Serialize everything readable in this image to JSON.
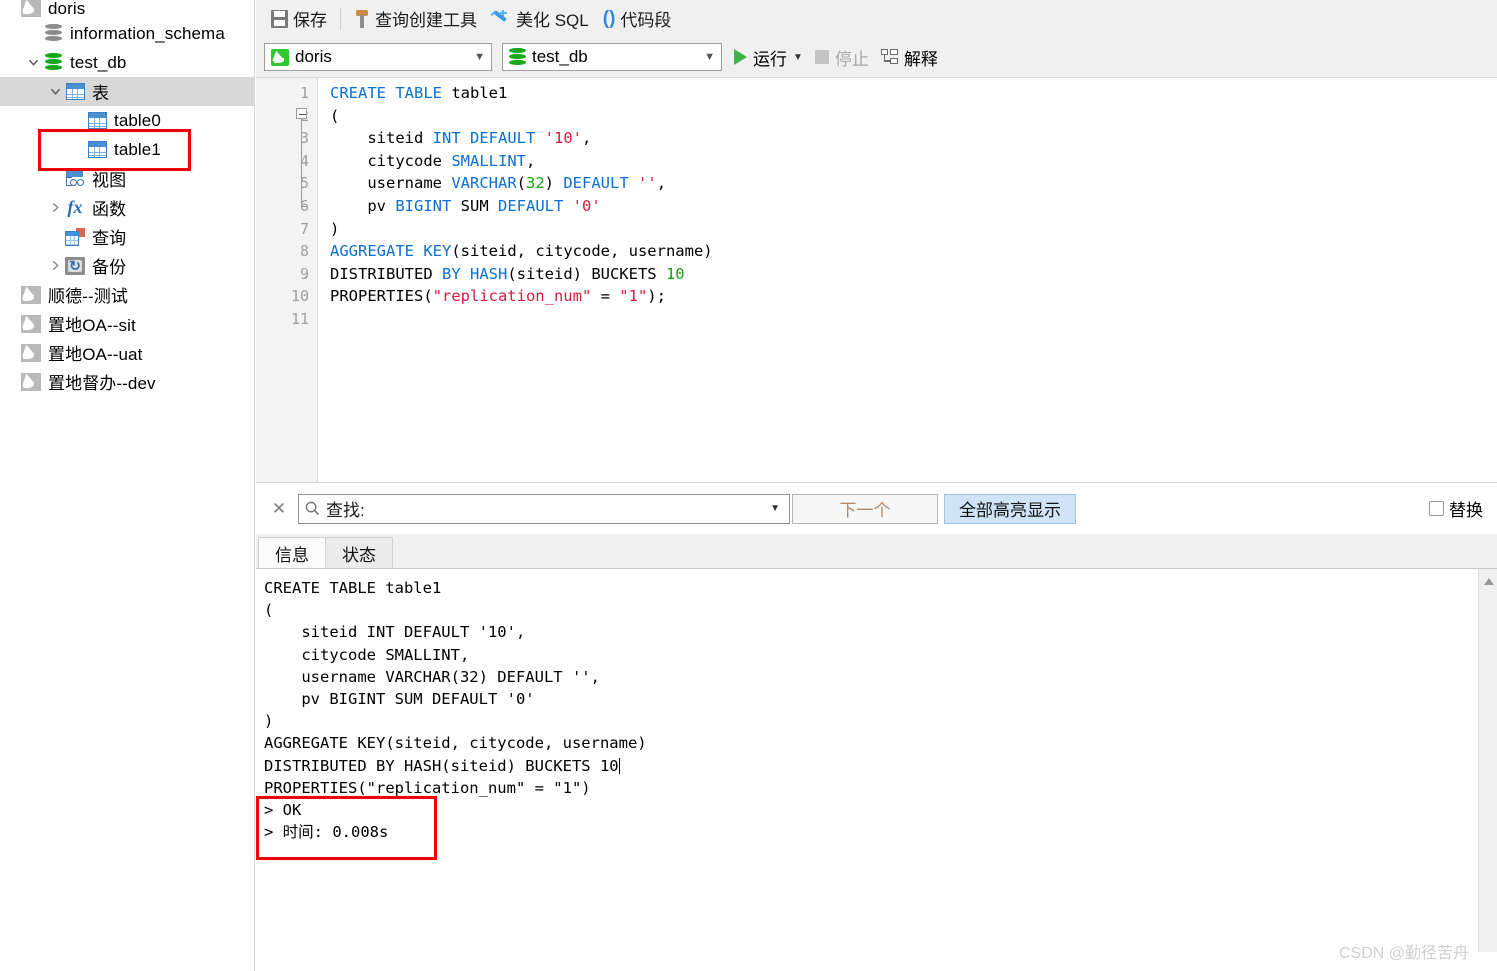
{
  "sidebar": {
    "items": [
      {
        "label": "doris",
        "icon": "mysql-connection-icon",
        "indent": 0,
        "twisty": "",
        "selected": false,
        "cut": true
      },
      {
        "label": "information_schema",
        "icon": "database-gray-icon",
        "indent": 1,
        "twisty": "",
        "selected": false
      },
      {
        "label": "test_db",
        "icon": "database-green-icon",
        "indent": 1,
        "twisty": "expanded",
        "selected": false
      },
      {
        "label": "表",
        "icon": "tables-folder-icon",
        "indent": 2,
        "twisty": "expanded",
        "selected": true
      },
      {
        "label": "table0",
        "icon": "table-icon",
        "indent": 3,
        "twisty": "",
        "selected": false
      },
      {
        "label": "table1",
        "icon": "table-icon",
        "indent": 3,
        "twisty": "",
        "selected": false,
        "highlighted": true
      },
      {
        "label": "视图",
        "icon": "view-icon",
        "indent": 2,
        "twisty": "",
        "selected": false
      },
      {
        "label": "函数",
        "icon": "function-fx-icon",
        "indent": 2,
        "twisty": "collapsed",
        "selected": false
      },
      {
        "label": "查询",
        "icon": "query-icon",
        "indent": 2,
        "twisty": "",
        "selected": false
      },
      {
        "label": "备份",
        "icon": "backup-icon",
        "indent": 2,
        "twisty": "collapsed",
        "selected": false
      },
      {
        "label": "顺德--测试",
        "icon": "mysql-connection-icon",
        "indent": 0,
        "twisty": "",
        "selected": false
      },
      {
        "label": "置地OA--sit",
        "icon": "mysql-connection-icon",
        "indent": 0,
        "twisty": "",
        "selected": false
      },
      {
        "label": "置地OA--uat",
        "icon": "mysql-connection-icon",
        "indent": 0,
        "twisty": "",
        "selected": false
      },
      {
        "label": "置地督办--dev",
        "icon": "mysql-connection-icon",
        "indent": 0,
        "twisty": "",
        "selected": false
      }
    ]
  },
  "toolbar": {
    "save_label": "保存",
    "query_builder_label": "查询创建工具",
    "beautify_label": "美化 SQL",
    "snippet_label": "代码段"
  },
  "connbar": {
    "connection_value": "doris",
    "database_value": "test_db",
    "run_label": "运行",
    "stop_label": "停止",
    "explain_label": "解释"
  },
  "editor": {
    "line_numbers": [
      "1",
      "2",
      "3",
      "4",
      "5",
      "6",
      "7",
      "8",
      "9",
      "10",
      "11"
    ],
    "lines": [
      "CREATE TABLE table1",
      "(",
      "    siteid INT DEFAULT '10',",
      "    citycode SMALLINT,",
      "    username VARCHAR(32) DEFAULT '',",
      "    pv BIGINT SUM DEFAULT '0'",
      ")",
      "AGGREGATE KEY(siteid, citycode, username)",
      "DISTRIBUTED BY HASH(siteid) BUCKETS 10",
      "PROPERTIES(\"replication_num\" = \"1\");",
      ""
    ]
  },
  "findbar": {
    "find_placeholder": "查找:",
    "find_value": "",
    "next_label": "下一个",
    "highlight_all_label": "全部高亮显示",
    "replace_label": "替换",
    "replace_checked": false
  },
  "result_tabs": [
    {
      "label": "信息",
      "active": true
    },
    {
      "label": "状态",
      "active": false
    }
  ],
  "output": {
    "lines": [
      "CREATE TABLE table1",
      "(",
      "    siteid INT DEFAULT '10',",
      "    citycode SMALLINT,",
      "    username VARCHAR(32) DEFAULT '',",
      "    pv BIGINT SUM DEFAULT '0'",
      ")",
      "AGGREGATE KEY(siteid, citycode, username)",
      "DISTRIBUTED BY HASH(siteid) BUCKETS 10",
      "PROPERTIES(\"replication_num\" = \"1\")"
    ],
    "status_lines": [
      "> OK",
      "> 时间: 0.008s"
    ]
  },
  "watermark": "CSDN @勤径苦舟",
  "colors": {
    "keyword": "#0b6fd4",
    "string": "#d81a3f",
    "number": "#12a50b",
    "highlight_box": "#f50000",
    "accent_blue": "#cfe4f7",
    "green": "#3bb54a"
  }
}
